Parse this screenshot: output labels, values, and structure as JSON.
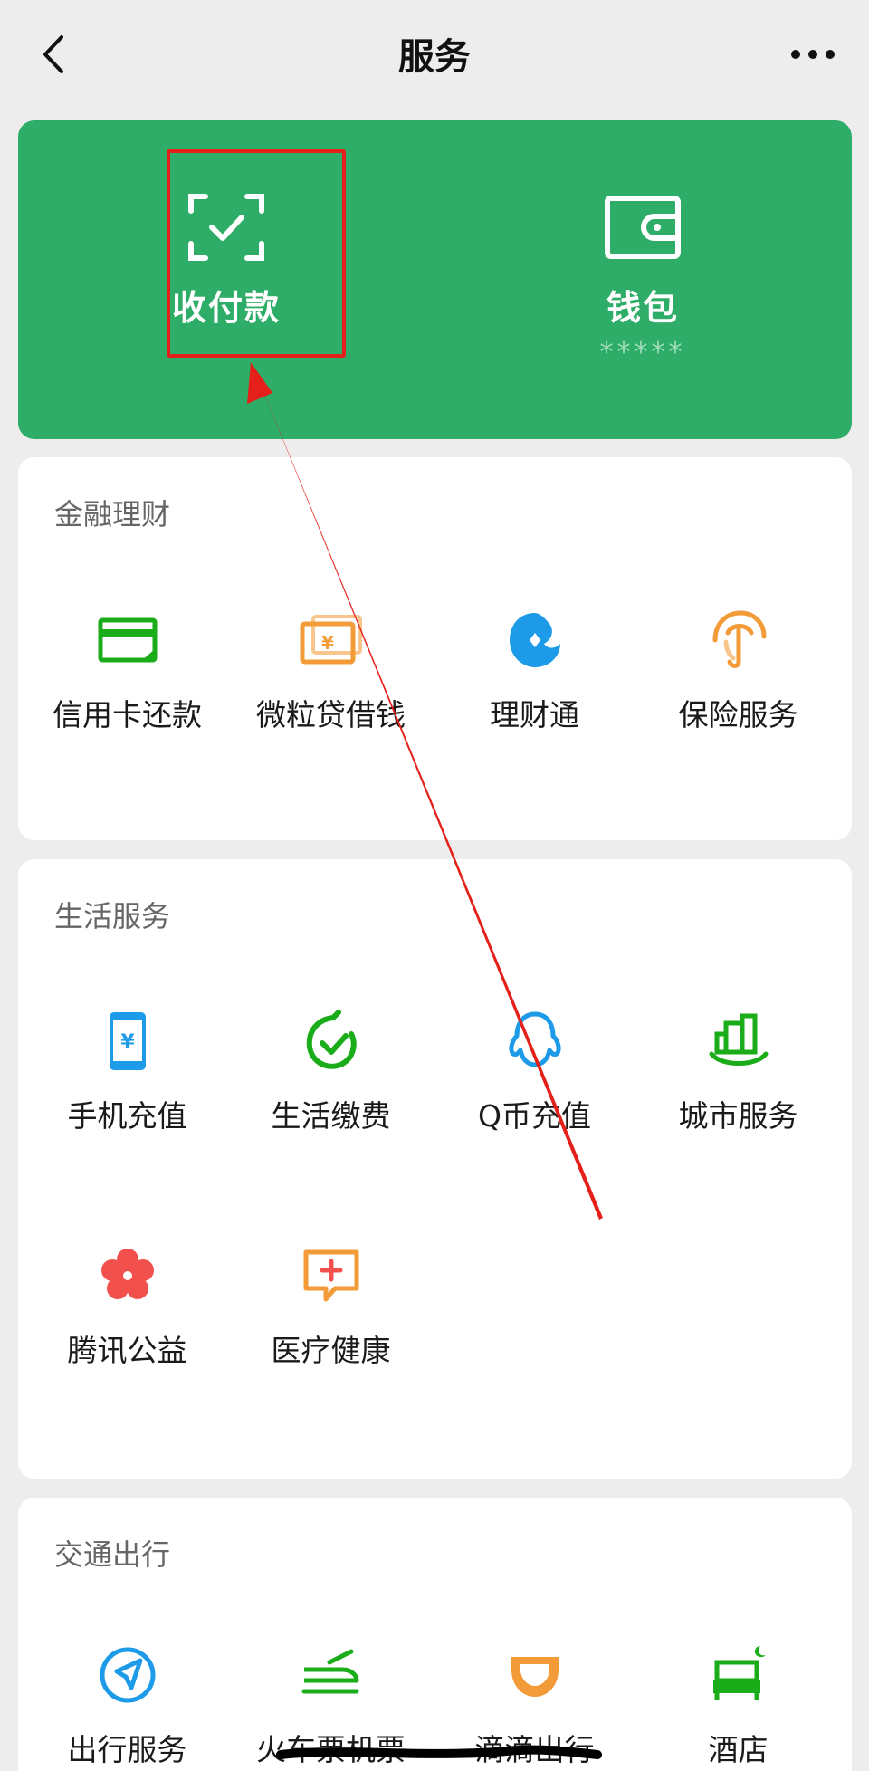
{
  "nav": {
    "title": "服务"
  },
  "hero": {
    "pay": {
      "label": "收付款"
    },
    "wallet": {
      "label": "钱包",
      "balance_masked": "*****"
    }
  },
  "sections": {
    "finance": {
      "title": "金融理财",
      "items": [
        "信用卡还款",
        "微粒贷借钱",
        "理财通",
        "保险服务"
      ]
    },
    "life": {
      "title": "生活服务",
      "items": [
        "手机充值",
        "生活缴费",
        "Q币充值",
        "城市服务",
        "腾讯公益",
        "医疗健康"
      ]
    },
    "transport": {
      "title": "交通出行",
      "items": [
        "出行服务",
        "火车票机票",
        "滴滴出行",
        "酒店"
      ]
    }
  },
  "colors": {
    "brand_green": "#2dad67",
    "highlight_red": "#e5201a",
    "icon_green": "#1aad19",
    "icon_orange": "#f29b38",
    "icon_blue": "#1e9be8",
    "icon_red": "#f2504d"
  },
  "icons": {
    "pay": "scan-check-icon",
    "wallet": "wallet-icon"
  }
}
